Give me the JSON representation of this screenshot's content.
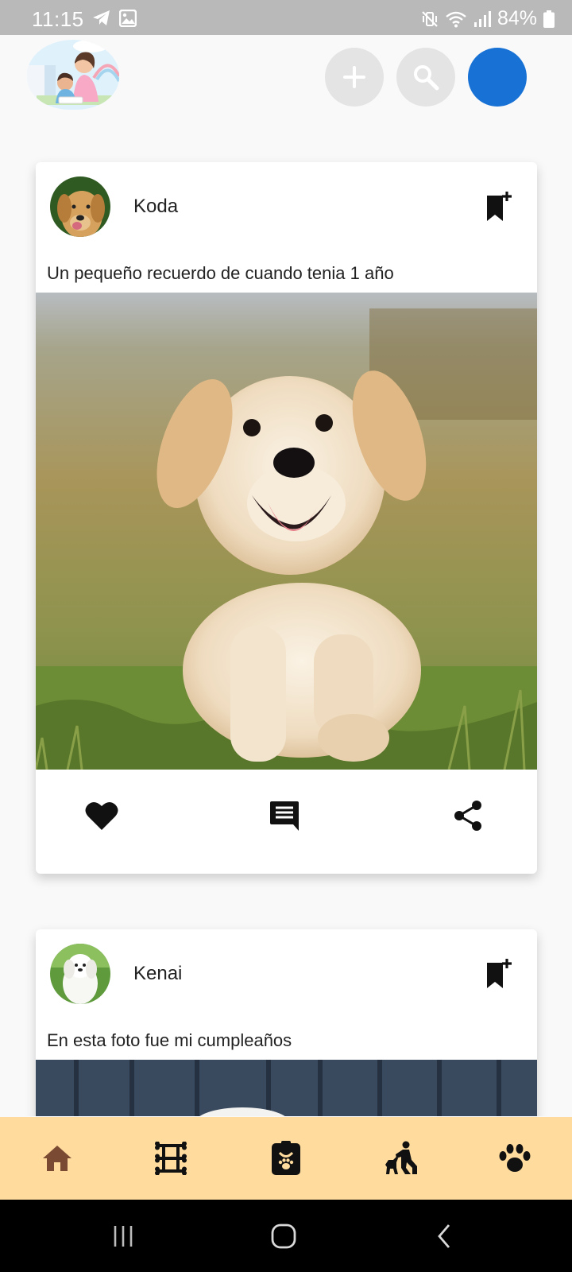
{
  "status_bar": {
    "time": "11:15",
    "battery_percent": "84%",
    "icons": [
      "telegram-icon",
      "gallery-icon",
      "vibrate-mute-icon",
      "wifi-icon",
      "signal-icon",
      "battery-icon"
    ]
  },
  "header": {
    "logo_icon": "app-logo-illustration",
    "buttons": [
      {
        "name": "add-post-button",
        "icon": "plus-icon"
      },
      {
        "name": "search-button",
        "icon": "search-icon"
      },
      {
        "name": "profile-button",
        "icon": "profile-avatar"
      }
    ]
  },
  "posts": [
    {
      "username": "Koda",
      "caption": "Un pequeño recuerdo de cuando tenia 1 año",
      "avatar_icon": "golden-retriever-avatar",
      "image_icon": "golden-retriever-puppy-photo",
      "actions": [
        "heart-icon",
        "comment-icon",
        "share-icon"
      ]
    },
    {
      "username": "Kenai",
      "caption": "En esta foto fue mi cumpleaños",
      "avatar_icon": "white-maltese-avatar",
      "image_icon": "maltese-birthday-photo"
    }
  ],
  "bottom_nav": {
    "items": [
      {
        "name": "home",
        "icon": "home-icon"
      },
      {
        "name": "bones",
        "icon": "bones-icon"
      },
      {
        "name": "pet-id",
        "icon": "pet-id-icon"
      },
      {
        "name": "walker",
        "icon": "dog-walker-icon"
      },
      {
        "name": "paw",
        "icon": "paw-icon"
      }
    ]
  },
  "system_nav": [
    "recents-icon",
    "home-circle-icon",
    "back-icon"
  ],
  "colors": {
    "status_bar": "#b9b9b9",
    "header_button": "#e4e4e4",
    "profile_blue": "#1872d6",
    "bottom_nav": "#ffdb9d",
    "home_icon": "#7a4a33"
  }
}
